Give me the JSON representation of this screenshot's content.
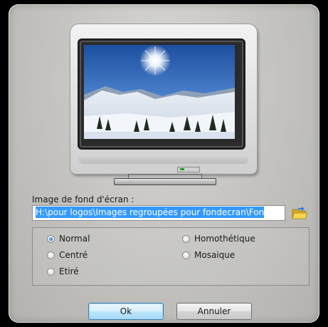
{
  "dialog": {
    "wallpaper_label": "Image de fond d'écran :",
    "wallpaper_path": "H:\\pour logos\\Images regroupées pour fondecran\\Fon",
    "options": {
      "normal": "Normal",
      "centre": "Centré",
      "etire": "Etiré",
      "homothetique": "Homothétique",
      "mosaique": "Mosaique",
      "selected": "Normal"
    },
    "ok_label": "Ok",
    "cancel_label": "Annuler"
  },
  "icons": {
    "monitor": "monitor-icon",
    "folder": "open-folder-icon"
  },
  "colors": {
    "selection": "#3399ff",
    "default_button": "#3c7fb1",
    "power_led": "#2aa02a"
  }
}
